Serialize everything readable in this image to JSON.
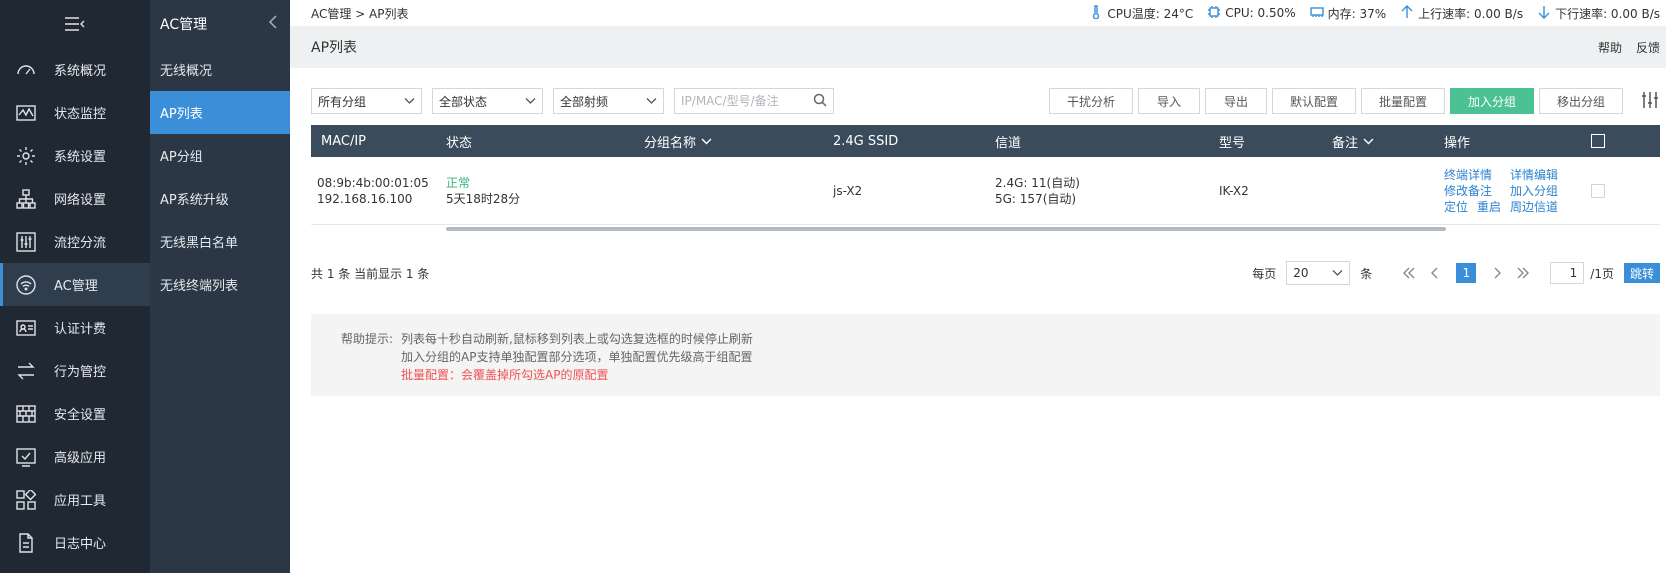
{
  "sidebar": {
    "items": [
      {
        "label": "系统概况",
        "icon": "dashboard-icon"
      },
      {
        "label": "状态监控",
        "icon": "monitor-icon"
      },
      {
        "label": "系统设置",
        "icon": "gear-icon"
      },
      {
        "label": "网络设置",
        "icon": "network-icon"
      },
      {
        "label": "流控分流",
        "icon": "sliders-icon"
      },
      {
        "label": "AC管理",
        "icon": "wifi-icon"
      },
      {
        "label": "认证计费",
        "icon": "id-card-icon"
      },
      {
        "label": "行为管控",
        "icon": "swap-icon"
      },
      {
        "label": "安全设置",
        "icon": "firewall-icon"
      },
      {
        "label": "高级应用",
        "icon": "check-board-icon"
      },
      {
        "label": "应用工具",
        "icon": "apps-icon"
      },
      {
        "label": "日志中心",
        "icon": "document-icon"
      }
    ],
    "active": "AC管理"
  },
  "subbar": {
    "title": "AC管理",
    "items": [
      "无线概况",
      "AP列表",
      "AP分组",
      "AP系统升级",
      "无线黑白名单",
      "无线终端列表"
    ],
    "active": "AP列表"
  },
  "topbar": {
    "breadcrumb": "AC管理 > AP列表",
    "cpu_temp": "CPU温度: 24°C",
    "cpu": "CPU: 0.50%",
    "memory": "内存: 37%",
    "upload": "上行速率: 0.00 B/s",
    "download": "下行速率: 0.00 B/s"
  },
  "titlebar": {
    "title": "AP列表",
    "help": "帮助",
    "feedback": "反馈"
  },
  "toolbar": {
    "group_select": "所有分组",
    "status_select": "全部状态",
    "band_select": "全部射频",
    "search_placeholder": "IP/MAC/型号/备注",
    "buttons": {
      "interference": "干扰分析",
      "import": "导入",
      "export": "导出",
      "default_config": "默认配置",
      "batch_config": "批量配置",
      "add_group": "加入分组",
      "remove_group": "移出分组"
    }
  },
  "table": {
    "headers": {
      "mac_ip": "MAC/IP",
      "status": "状态",
      "group": "分组名称",
      "ssid": "2.4G SSID",
      "channel": "信道",
      "model": "型号",
      "remark": "备注",
      "ops": "操作"
    },
    "rows": [
      {
        "mac": "08:9b:4b:00:01:05",
        "ip": "192.168.16.100",
        "status": "正常",
        "uptime": "5天18时28分",
        "group": "",
        "ssid": "js-X2",
        "channel_24": "2.4G: 11(自动)",
        "channel_5": "5G: 157(自动)",
        "model": "IK-X2",
        "remark": "",
        "ops": [
          "终端详情",
          "详情编辑",
          "修改备注",
          "加入分组",
          "定位",
          "重启",
          "周边信道"
        ]
      }
    ]
  },
  "pager": {
    "summary": "共 1 条 当前显示 1 条",
    "per_page_label": "每页",
    "per_page": "20",
    "unit": "条",
    "current": "1",
    "input_value": "1",
    "total": "/1页",
    "jump": "跳转"
  },
  "help": {
    "label": "帮助提示:",
    "lines": [
      "列表每十秒自动刷新,鼠标移到列表上或勾选复选框的时候停止刷新",
      "加入分组的AP支持单独配置部分选项，单独配置优先级高于组配置"
    ],
    "warning": "批量配置：会覆盖掉所勾选AP的原配置"
  },
  "colors": {
    "sidebar_bg": "#1f2833",
    "subbar_bg": "#2b3744",
    "accent": "#3a8fd8",
    "success": "#4cc193",
    "table_header": "#3a4b5c",
    "warning": "#f05252"
  }
}
